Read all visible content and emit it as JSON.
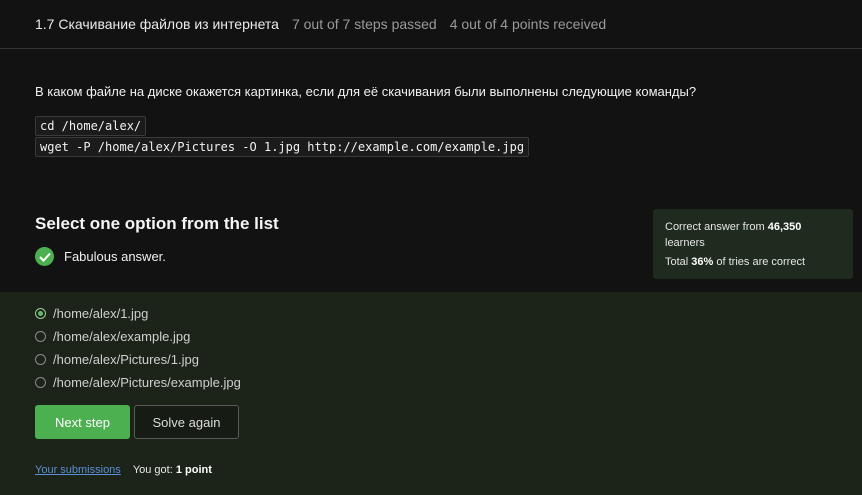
{
  "header": {
    "title": "1.7 Скачивание файлов из интернета",
    "steps": "7 out of 7 steps passed",
    "points": "4 out of 4 points  received"
  },
  "question": {
    "text": "В каком файле на диске окажется картинка, если для её скачивания были выполнены следующие команды?",
    "code_lines": [
      "cd /home/alex/",
      "wget -P /home/alex/Pictures -O 1.jpg http://example.com/example.jpg"
    ]
  },
  "quiz": {
    "prompt": "Select one option from the list",
    "feedback": "Fabulous answer.",
    "stats": {
      "line1_prefix": "Correct answer from ",
      "learners_count": "46,350",
      "line1_suffix": "learners",
      "line2_prefix": "Total ",
      "percent": "36%",
      "line2_suffix": " of tries are correct"
    },
    "options": [
      {
        "label": "/home/alex/1.jpg",
        "selected": true
      },
      {
        "label": "/home/alex/example.jpg",
        "selected": false
      },
      {
        "label": "/home/alex/Pictures/1.jpg",
        "selected": false
      },
      {
        "label": "/home/alex/Pictures/example.jpg",
        "selected": false
      }
    ],
    "next_label": "Next step",
    "again_label": "Solve again"
  },
  "footer": {
    "submissions_link": "Your submissions",
    "got_prefix": "You got: ",
    "got_value": "1 point"
  },
  "colors": {
    "accent": "#4caf50",
    "link": "#5b8fd6"
  }
}
